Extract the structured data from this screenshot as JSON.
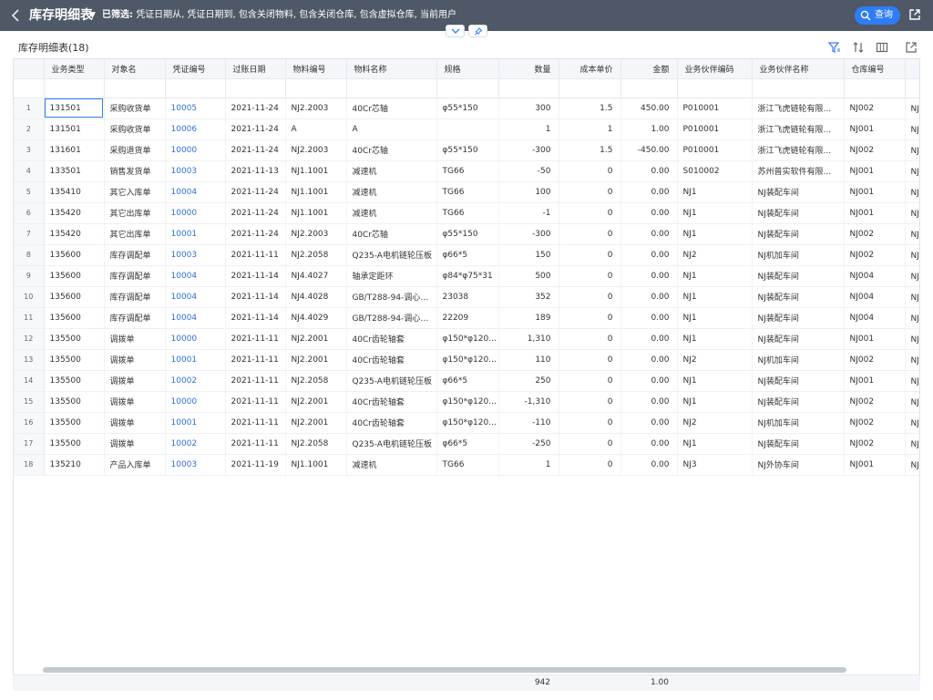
{
  "header": {
    "title": "库存明细表",
    "filter_prefix": "已筛选:",
    "filter_text": "凭证日期从, 凭证日期到, 包含关闭物料, 包含关闭仓库, 包含虚拟仓库, 当前用户",
    "query_label": "查询"
  },
  "subheader": {
    "title": "库存明细表(18)"
  },
  "table": {
    "columns": [
      {
        "key": "type",
        "label": "业务类型"
      },
      {
        "key": "obj",
        "label": "对象名"
      },
      {
        "key": "voucher",
        "label": "凭证编号"
      },
      {
        "key": "date",
        "label": "过账日期"
      },
      {
        "key": "mat_code",
        "label": "物料编号"
      },
      {
        "key": "mat_name",
        "label": "物料名称"
      },
      {
        "key": "spec",
        "label": "规格"
      },
      {
        "key": "qty",
        "label": "数量"
      },
      {
        "key": "unit_cost",
        "label": "成本单价"
      },
      {
        "key": "amount",
        "label": "金额"
      },
      {
        "key": "partner_code",
        "label": "业务伙伴编码"
      },
      {
        "key": "partner_name",
        "label": "业务伙伴名称"
      },
      {
        "key": "wh_code",
        "label": "仓库编号"
      },
      {
        "key": "wh_name",
        "label": ""
      }
    ],
    "rows": [
      [
        "1",
        "131501",
        "采购收货单",
        "10005",
        "2021-11-24",
        "NJ2.2003",
        "40Cr芯轴",
        "φ55*150",
        "300",
        "1.5",
        "450.00",
        "P010001",
        "浙江飞虎链轮有限...",
        "NJ002",
        "NJ半"
      ],
      [
        "2",
        "131501",
        "采购收货单",
        "10006",
        "2021-11-24",
        "A",
        "A",
        "",
        "1",
        "1",
        "1.00",
        "P010001",
        "浙江飞虎链轮有限...",
        "NJ001",
        "NJ成"
      ],
      [
        "3",
        "131601",
        "采购退货单",
        "10000",
        "2021-11-24",
        "NJ2.2003",
        "40Cr芯轴",
        "φ55*150",
        "-300",
        "1.5",
        "-450.00",
        "P010001",
        "浙江飞虎链轮有限...",
        "NJ002",
        "NJ半"
      ],
      [
        "4",
        "133501",
        "销售发货单",
        "10003",
        "2021-11-13",
        "NJ1.1001",
        "减速机",
        "TG66",
        "-50",
        "0",
        "0.00",
        "S010002",
        "苏州普实软件有限...",
        "NJ001",
        "NJ成"
      ],
      [
        "5",
        "135410",
        "其它入库单",
        "10004",
        "2021-11-24",
        "NJ1.1001",
        "减速机",
        "TG66",
        "100",
        "0",
        "0.00",
        "NJ1",
        "NJ装配车间",
        "NJ001",
        "NJ成"
      ],
      [
        "6",
        "135420",
        "其它出库单",
        "10000",
        "2021-11-24",
        "NJ1.1001",
        "减速机",
        "TG66",
        "-1",
        "0",
        "0.00",
        "NJ1",
        "NJ装配车间",
        "NJ001",
        "NJ成"
      ],
      [
        "7",
        "135420",
        "其它出库单",
        "10001",
        "2021-11-24",
        "NJ2.2003",
        "40Cr芯轴",
        "φ55*150",
        "-300",
        "0",
        "0.00",
        "NJ1",
        "NJ装配车间",
        "NJ002",
        "NJ半"
      ],
      [
        "8",
        "135600",
        "库存调配单",
        "10003",
        "2021-11-11",
        "NJ2.2058",
        "Q235-A电机链轮压板",
        "φ66*5",
        "150",
        "0",
        "0.00",
        "NJ2",
        "NJ机加车间",
        "NJ002",
        "NJ半"
      ],
      [
        "9",
        "135600",
        "库存调配单",
        "10004",
        "2021-11-14",
        "NJ4.4027",
        "轴承定距环",
        "φ84*φ75*31",
        "500",
        "0",
        "0.00",
        "NJ1",
        "NJ装配车间",
        "NJ004",
        "NJ半"
      ],
      [
        "10",
        "135600",
        "库存调配单",
        "10004",
        "2021-11-14",
        "NJ4.4028",
        "GB/T288-94-调心滚...",
        "23038",
        "352",
        "0",
        "0.00",
        "NJ1",
        "NJ装配车间",
        "NJ004",
        "NJ五"
      ],
      [
        "11",
        "135600",
        "库存调配单",
        "10004",
        "2021-11-14",
        "NJ4.4029",
        "GB/T288-94-调心滚...",
        "22209",
        "189",
        "0",
        "0.00",
        "NJ1",
        "NJ装配车间",
        "NJ004",
        "NJ五"
      ],
      [
        "12",
        "135500",
        "调拨单",
        "10000",
        "2021-11-11",
        "NJ2.2001",
        "40Cr齿轮轴套",
        "φ150*φ120...",
        "1,310",
        "0",
        "0.00",
        "NJ1",
        "NJ装配车间",
        "NJ001",
        "NJ成"
      ],
      [
        "13",
        "135500",
        "调拨单",
        "10001",
        "2021-11-11",
        "NJ2.2001",
        "40Cr齿轮轴套",
        "φ150*φ120...",
        "110",
        "0",
        "0.00",
        "NJ2",
        "NJ机加车间",
        "NJ002",
        "NJ半"
      ],
      [
        "14",
        "135500",
        "调拨单",
        "10002",
        "2021-11-11",
        "NJ2.2058",
        "Q235-A电机链轮压板",
        "φ66*5",
        "250",
        "0",
        "0.00",
        "NJ1",
        "NJ装配车间",
        "NJ001",
        "NJ成"
      ],
      [
        "15",
        "135500",
        "调拨单",
        "10000",
        "2021-11-11",
        "NJ2.2001",
        "40Cr齿轮轴套",
        "φ150*φ120...",
        "-1,310",
        "0",
        "0.00",
        "NJ1",
        "NJ装配车间",
        "NJ002",
        "NJ半"
      ],
      [
        "16",
        "135500",
        "调拨单",
        "10001",
        "2021-11-11",
        "NJ2.2001",
        "40Cr齿轮轴套",
        "φ150*φ120...",
        "-110",
        "0",
        "0.00",
        "NJ2",
        "NJ机加车间",
        "NJ002",
        "NJ半"
      ],
      [
        "17",
        "135500",
        "调拨单",
        "10002",
        "2021-11-11",
        "NJ2.2058",
        "Q235-A电机链轮压板",
        "φ66*5",
        "-250",
        "0",
        "0.00",
        "NJ1",
        "NJ装配车间",
        "NJ002",
        "NJ半"
      ],
      [
        "18",
        "135210",
        "产品入库单",
        "10003",
        "2021-11-19",
        "NJ1.1001",
        "减速机",
        "TG66",
        "1",
        "0",
        "0.00",
        "NJ3",
        "NJ外协车间",
        "NJ001",
        "NJ成"
      ]
    ],
    "totals": {
      "qty": "942",
      "amount": "1.00"
    }
  },
  "icons": {
    "back": "chevron-left-icon",
    "title_dropdown": "caret-down-icon",
    "query": "search-icon",
    "share": "external-link-icon",
    "collapse": "chevron-down-icon",
    "pin": "pin-icon",
    "filter": "filter-icon",
    "sort": "sort-icon",
    "columns": "columns-icon",
    "export": "export-icon"
  },
  "colors": {
    "topbar": "#4f5867",
    "accent": "#2f7cf6",
    "link": "#2f6fd6"
  }
}
